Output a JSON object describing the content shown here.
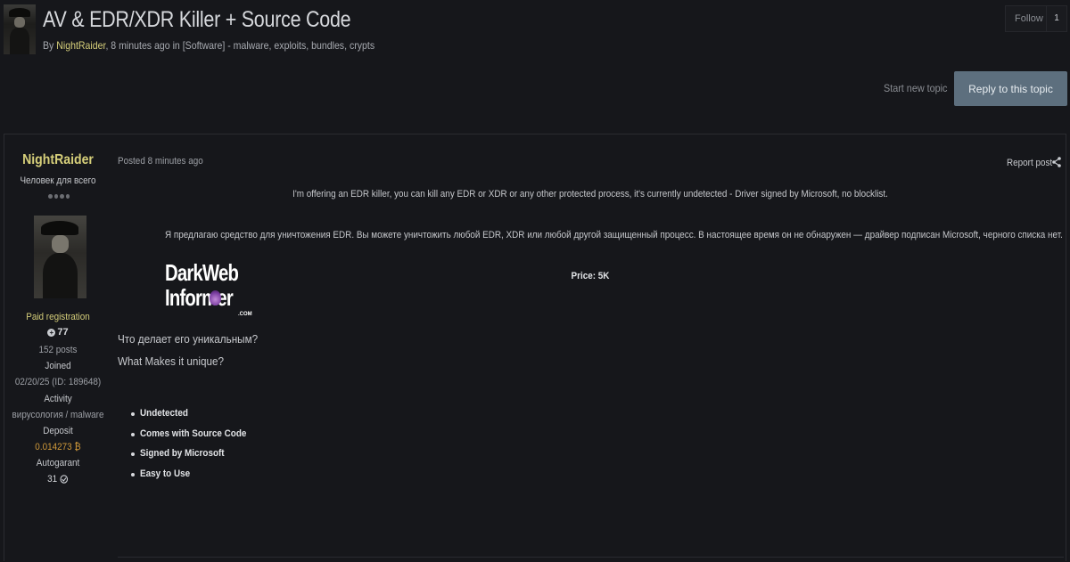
{
  "topic": {
    "title": "AV & EDR/XDR Killer + Source Code",
    "meta_prefix": "By ",
    "author": "NightRaider",
    "meta_suffix": ", 8 minutes ago in [Software] - malware, exploits, bundles, crypts"
  },
  "follow": {
    "label": "Follow",
    "count": "1"
  },
  "actions": {
    "start_new_topic": "Start new topic",
    "reply": "Reply to this topic"
  },
  "author": {
    "name": "NightRaider",
    "title": "Человек для всего",
    "group": "Paid registration",
    "reputation": "77",
    "posts": "152 posts",
    "joined_label": "Joined",
    "joined_value": "02/20/25 (ID: 189648)",
    "activity_label": "Activity",
    "activity_value": "вирусология / malware",
    "deposit_label": "Deposit",
    "deposit_value": "0.014273 ₿",
    "autogarant_label": "Autogarant",
    "autogarant_value": "31"
  },
  "post": {
    "date": "Posted 8 minutes ago",
    "report": "Report post",
    "line_en": "I'm offering an EDR killer, you can kill any EDR or  XDR or any other protected process, it's currently undetected - Driver signed by Microsoft, no blocklist.",
    "line_ru": "Я предлагаю средство для уничтожения EDR. Вы можете уничтожить любой EDR, XDR или любой другой защищенный процесс. В настоящее время он не обнаружен — драйвер подписан Microsoft, черного списка нет.",
    "price": "Price: 5K",
    "logo_line1": "DarkWeb",
    "logo_line2": "Informer",
    "logo_com": ".COM",
    "unique_ru": "Что делает его уникальным?",
    "unique_en": "What Makes it unique?",
    "features": [
      "Undetected",
      "Comes with Source Code",
      "Signed by Microsoft",
      "Easy to Use"
    ]
  },
  "colors": {
    "accent_author": "#d6cf7a",
    "reply_button": "#5d6f7e",
    "deposit": "#d19a3a",
    "background": "#16171b"
  },
  "icons": {
    "share": "share-icon",
    "reputation": "plus-circle-icon",
    "autogarant": "handshake-icon"
  }
}
